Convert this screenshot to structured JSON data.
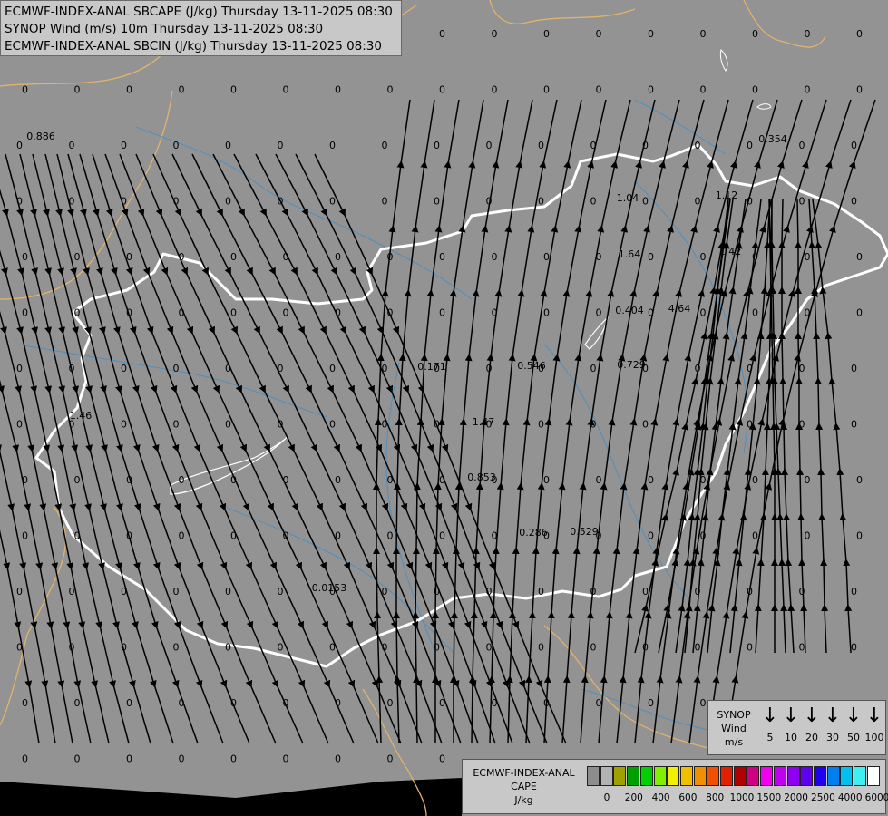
{
  "titles": [
    "ECMWF-INDEX-ANAL SBCAPE (J/kg) Thursday 13-11-2025 08:30",
    "SYNOP Wind (m/s) 10m Thursday 13-11-2025 08:30",
    "ECMWF-INDEX-ANAL SBCIN (J/kg) Thursday 13-11-2025 08:30"
  ],
  "colors": {
    "background": "#939393",
    "border": "#ffffff",
    "neighbor_border": "#e0b36a",
    "rivers": "#4f8fbf",
    "streamlines": "#000000",
    "panel": "#c8c8c8"
  },
  "cape_labels": [
    "0.886",
    "1.04",
    "1.12",
    "1.64",
    "1.42",
    "0.404",
    "4.64",
    "0.171",
    "0.546",
    "0.729",
    "1.46",
    "1.47",
    "0.853",
    "0.286",
    "0.529",
    "0.0153",
    "0.354"
  ],
  "synop_legend": {
    "title": [
      "SYNOP",
      "Wind",
      "m/s"
    ],
    "speeds": [
      "5",
      "10",
      "20",
      "30",
      "50",
      "100"
    ],
    "arrow_icon": "down-arrow-icon"
  },
  "cape_legend": {
    "title": [
      "ECMWF-INDEX-ANAL",
      "CAPE",
      "J/kg"
    ],
    "colors": [
      "#8c8c8c",
      "#b2b2b2",
      "#a0a000",
      "#00a000",
      "#00d000",
      "#80f000",
      "#f0f000",
      "#f0c000",
      "#f09000",
      "#f05000",
      "#e02000",
      "#b00000",
      "#d00080",
      "#f000f0",
      "#c000f0",
      "#9000f0",
      "#6000f0",
      "#2000f0",
      "#0080f0",
      "#00c0f0",
      "#40f0f0",
      "#ffffff"
    ],
    "ticks": [
      "0",
      "200",
      "400",
      "600",
      "800",
      "1000",
      "1500",
      "2000",
      "2500",
      "4000",
      "6000"
    ]
  }
}
